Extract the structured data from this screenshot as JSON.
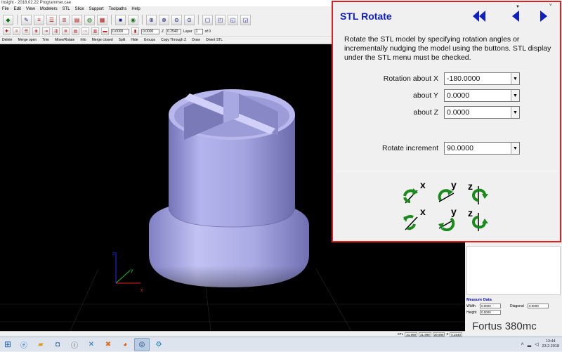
{
  "window": {
    "title": "Insight - 2018.02.22 Programmer.cae"
  },
  "menu": [
    "File",
    "Edit",
    "View",
    "Modelers",
    "STL",
    "Slice",
    "Support",
    "Toolpaths",
    "Help"
  ],
  "toolbar2": {
    "field1": "0.0000",
    "field2": "0.0000",
    "z_label": "Z",
    "z_value": "0.2540",
    "layer_label": "Layer",
    "layer_value": "1",
    "of_label": "of 0"
  },
  "commands": [
    "Delete",
    "Merge open",
    "Trim",
    "Move/Rotate",
    "Info",
    "Merge closed",
    "Split",
    "Hide",
    "Groups",
    "Copy Through Z",
    "Draw",
    "Orient STL"
  ],
  "dialog": {
    "title": "STL Rotate",
    "description": "Rotate the STL model by specifying rotation angles or incrementally nudging the model using the buttons. STL display under the STL menu must be checked.",
    "rotation_x_label": "Rotation about X",
    "rotation_x_value": "-180.0000",
    "rotation_y_label": "about Y",
    "rotation_y_value": "0.0000",
    "rotation_z_label": "about Z",
    "rotation_z_value": "0.0000",
    "increment_label": "Rotate increment",
    "increment_value": "90.0000",
    "axis_x": "x",
    "axis_y": "y",
    "axis_z": "z"
  },
  "measure": {
    "title": "Measure Data",
    "width_label": "Width",
    "width_value": "0.0000",
    "height_label": "Height",
    "height_value": "0.0000",
    "diagonal_label": "Diagonal",
    "diagonal_value": "0.0000"
  },
  "brand": {
    "name": "Fortus",
    "model": "380mc"
  },
  "status": {
    "label": "STL",
    "v1": "31.998",
    "v2": "31.998",
    "v3": "39.998",
    "z_label": "Z",
    "z_value": "0.2540"
  },
  "taskbar": {
    "time": "13:44",
    "date": "23.2.2018"
  },
  "colors": {
    "dialog_border": "#e02020",
    "title_blue": "#1020c0",
    "model": "#a6a6e4",
    "arrow_green": "#1a8a1a"
  }
}
